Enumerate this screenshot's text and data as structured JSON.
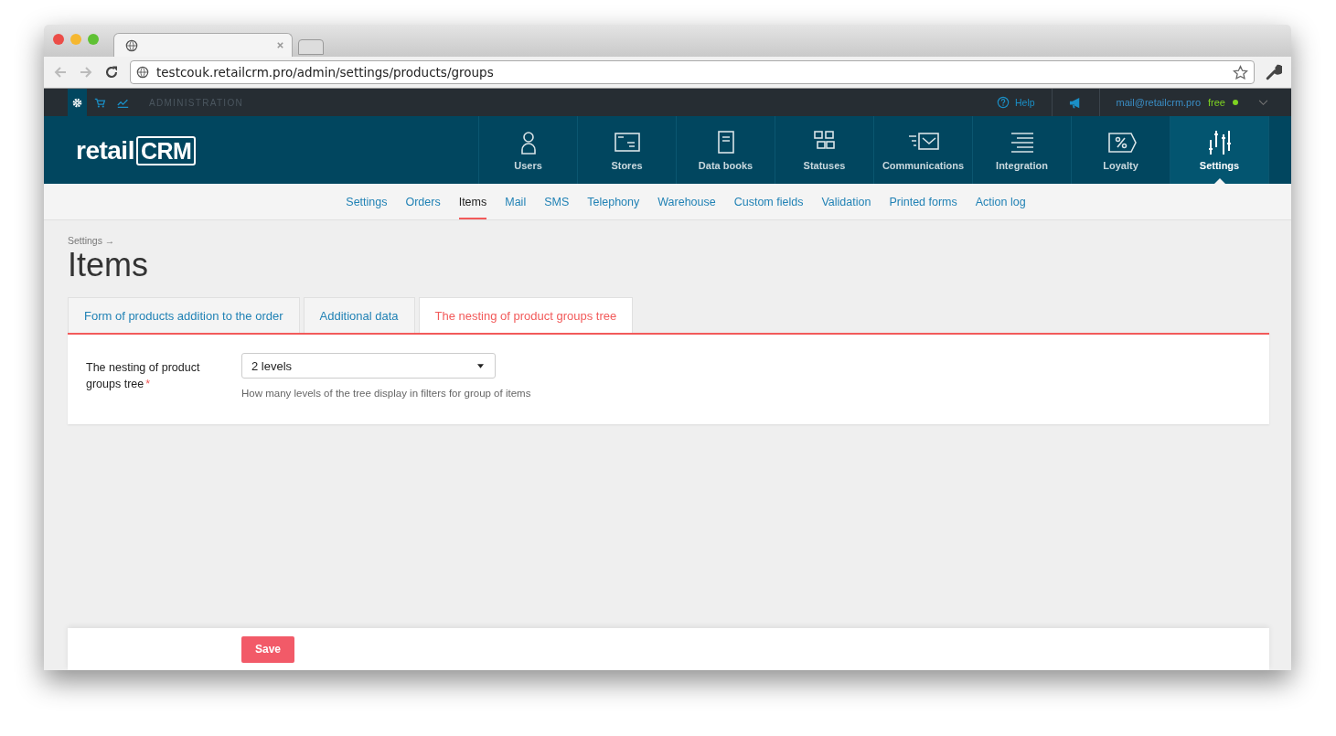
{
  "browser": {
    "url": "testcouk.retailcrm.pro/admin/settings/products/groups"
  },
  "admin_bar": {
    "icons": [
      {
        "selected": true
      },
      {
        "selected": false
      },
      {
        "selected": false
      }
    ],
    "section": "ADMINISTRATION",
    "help": "Help",
    "email": "mail@retailcrm.pro",
    "plan": "free"
  },
  "logo": {
    "prefix": "retail",
    "suffix": "CRM"
  },
  "nav": [
    {
      "label": "Users",
      "selected": false
    },
    {
      "label": "Stores",
      "selected": false
    },
    {
      "label": "Data books",
      "selected": false
    },
    {
      "label": "Statuses",
      "selected": false
    },
    {
      "label": "Communications",
      "selected": false
    },
    {
      "label": "Integration",
      "selected": false
    },
    {
      "label": "Loyalty",
      "selected": false
    },
    {
      "label": "Settings",
      "selected": true
    }
  ],
  "subnav": [
    {
      "label": "Settings",
      "selected": false
    },
    {
      "label": "Orders",
      "selected": false
    },
    {
      "label": "Items",
      "selected": true
    },
    {
      "label": "Mail",
      "selected": false
    },
    {
      "label": "SMS",
      "selected": false
    },
    {
      "label": "Telephony",
      "selected": false
    },
    {
      "label": "Warehouse",
      "selected": false
    },
    {
      "label": "Custom fields",
      "selected": false
    },
    {
      "label": "Validation",
      "selected": false
    },
    {
      "label": "Printed forms",
      "selected": false
    },
    {
      "label": "Action log",
      "selected": false
    }
  ],
  "breadcrumb": "Settings →",
  "title": "Items",
  "tabs": [
    {
      "label": "Form of products addition to the order",
      "selected": false
    },
    {
      "label": "Additional data",
      "selected": false
    },
    {
      "label": "The nesting of product groups tree",
      "selected": true
    }
  ],
  "form": {
    "label": "The nesting of product groups tree",
    "required_mark": "*",
    "value": "2 levels",
    "hint": "How many levels of the tree display in filters for group of items"
  },
  "save": "Save"
}
